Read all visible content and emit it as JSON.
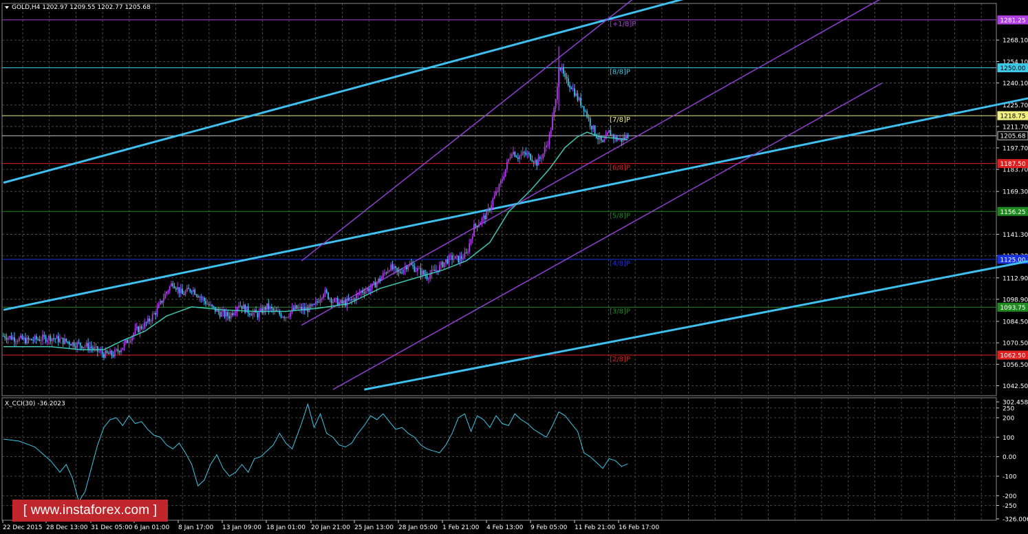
{
  "header": {
    "symbol_line": "GOLD,H4  1202.97 1209.55 1202.77 1205.68",
    "cci_line": "X_CCI(30) -36.2023"
  },
  "price_axis": {
    "ticks": [
      1268.1,
      1254.1,
      1240.1,
      1225.7,
      1211.7,
      1197.7,
      1183.7,
      1169.3,
      1141.3,
      1127.3,
      1112.9,
      1098.9,
      1084.5,
      1070.5,
      1056.5,
      1042.5
    ]
  },
  "time_axis": {
    "labels": [
      "22 Dec 2015",
      "28 Dec 13:00",
      "31 Dec 05:00",
      "6 Jan 01:00",
      "8 Jan 17:00",
      "13 Jan 09:00",
      "18 Jan 01:00",
      "20 Jan 21:00",
      "25 Jan 13:00",
      "28 Jan 05:00",
      "1 Feb 21:00",
      "4 Feb 13:00",
      "9 Feb 05:00",
      "11 Feb 21:00",
      "16 Feb 17:00"
    ]
  },
  "levels": [
    {
      "label": "[+1/8]P",
      "value": 1281.25,
      "value_text": "1281.25",
      "color": "#b040e0"
    },
    {
      "label": "[8/8]P",
      "value": 1250.0,
      "value_text": "1250.00",
      "color": "#3ec8e8"
    },
    {
      "label": "[7/8]P",
      "value": 1218.75,
      "value_text": "1218.75",
      "color": "#f0f080"
    },
    {
      "label": "",
      "value": 1205.68,
      "value_text": "1205.68",
      "color": "#c8c8c8"
    },
    {
      "label": "[6/8]P",
      "value": 1187.5,
      "value_text": "1187.50",
      "color": "#e02020"
    },
    {
      "label": "[5/8]P",
      "value": 1156.25,
      "value_text": "1156.25",
      "color": "#1f8a1f"
    },
    {
      "label": "[4/8]P",
      "value": 1125.0,
      "value_text": "1125.00",
      "color": "#1a33e0"
    },
    {
      "label": "[3/8]P",
      "value": 1093.75,
      "value_text": "1093.75",
      "color": "#1f8a1f"
    },
    {
      "label": "[2/8]P",
      "value": 1062.5,
      "value_text": "1062.50",
      "color": "#e02020"
    }
  ],
  "cci_axis": {
    "ticks": [
      "302.4585",
      "250",
      "200",
      "100",
      "0.00",
      "-100",
      "-200",
      "-250",
      "-326.0061"
    ]
  },
  "chart_data": [
    {
      "type": "candlestick",
      "title": "GOLD,H4",
      "ylim": [
        1036,
        1292
      ],
      "bar_count": 300,
      "close_path": [
        [
          0,
          1075
        ],
        [
          15,
          1072
        ],
        [
          30,
          1074
        ],
        [
          45,
          1070
        ],
        [
          55,
          1068
        ],
        [
          64,
          1063
        ],
        [
          70,
          1063
        ],
        [
          76,
          1068
        ],
        [
          84,
          1078
        ],
        [
          92,
          1084
        ],
        [
          98,
          1092
        ],
        [
          104,
          1104
        ],
        [
          108,
          1110
        ],
        [
          114,
          1102
        ],
        [
          120,
          1106
        ],
        [
          126,
          1100
        ],
        [
          132,
          1094
        ],
        [
          138,
          1090
        ],
        [
          144,
          1088
        ],
        [
          150,
          1096
        ],
        [
          156,
          1091
        ],
        [
          162,
          1089
        ],
        [
          168,
          1094
        ],
        [
          174,
          1090
        ],
        [
          180,
          1088
        ],
        [
          186,
          1093
        ],
        [
          192,
          1092
        ],
        [
          198,
          1094
        ],
        [
          204,
          1104
        ],
        [
          210,
          1098
        ],
        [
          216,
          1096
        ],
        [
          222,
          1098
        ],
        [
          228,
          1104
        ],
        [
          234,
          1106
        ],
        [
          240,
          1112
        ],
        [
          246,
          1120
        ],
        [
          252,
          1116
        ],
        [
          258,
          1122
        ],
        [
          264,
          1118
        ],
        [
          270,
          1114
        ],
        [
          276,
          1118
        ],
        [
          282,
          1124
        ],
        [
          286,
          1126
        ],
        [
          290,
          1125
        ],
        [
          295,
          1128
        ],
        [
          300,
          1146
        ],
        [
          304,
          1150
        ],
        [
          308,
          1154
        ],
        [
          312,
          1164
        ],
        [
          316,
          1172
        ],
        [
          320,
          1184
        ],
        [
          324,
          1196
        ],
        [
          328,
          1192
        ],
        [
          332,
          1194
        ],
        [
          336,
          1192
        ],
        [
          340,
          1188
        ],
        [
          344,
          1194
        ],
        [
          348,
          1205
        ],
        [
          352,
          1228
        ],
        [
          354,
          1252
        ],
        [
          356,
          1248
        ],
        [
          358,
          1242
        ],
        [
          362,
          1238
        ],
        [
          366,
          1230
        ],
        [
          370,
          1224
        ],
        [
          374,
          1214
        ],
        [
          378,
          1206
        ],
        [
          382,
          1200
        ],
        [
          386,
          1208
        ],
        [
          390,
          1204
        ],
        [
          394,
          1203
        ],
        [
          398,
          1205.68
        ]
      ],
      "moving_average_path": [
        [
          0,
          1068
        ],
        [
          30,
          1068
        ],
        [
          50,
          1066
        ],
        [
          64,
          1066
        ],
        [
          76,
          1072
        ],
        [
          90,
          1078
        ],
        [
          104,
          1088
        ],
        [
          120,
          1094
        ],
        [
          140,
          1092
        ],
        [
          160,
          1091
        ],
        [
          180,
          1091
        ],
        [
          200,
          1093
        ],
        [
          220,
          1096
        ],
        [
          240,
          1106
        ],
        [
          260,
          1112
        ],
        [
          280,
          1118
        ],
        [
          295,
          1124
        ],
        [
          310,
          1136
        ],
        [
          322,
          1156
        ],
        [
          336,
          1170
        ],
        [
          348,
          1184
        ],
        [
          358,
          1198
        ],
        [
          366,
          1205
        ],
        [
          372,
          1208
        ],
        [
          380,
          1205
        ],
        [
          390,
          1204
        ],
        [
          398,
          1203
        ]
      ],
      "trend_lines": [
        {
          "name": "upper-blue",
          "points": [
            [
              0,
              1175
            ],
            [
              470,
              1305
            ]
          ],
          "color": "#3ec0f0"
        },
        {
          "name": "middle-blue",
          "points": [
            [
              0,
              1092
            ],
            [
              700,
              1240
            ]
          ],
          "color": "#3ec0f0"
        },
        {
          "name": "lower-blue",
          "points": [
            [
              230,
              1040
            ],
            [
              700,
              1133
            ]
          ],
          "color": "#3ec0f0"
        },
        {
          "name": "channel-upper",
          "points": [
            [
              190,
              1124
            ],
            [
              420,
              1310
            ]
          ],
          "color": "#9040d0"
        },
        {
          "name": "channel-mid",
          "points": [
            [
              190,
              1082
            ],
            [
              620,
              1330
            ]
          ],
          "color": "#9040d0"
        },
        {
          "name": "channel-lower",
          "points": [
            [
              210,
              1040
            ],
            [
              560,
              1240
            ]
          ],
          "color": "#9040d0"
        }
      ]
    },
    {
      "type": "line",
      "title": "X_CCI(30) -36.2023",
      "ylim": [
        -326.0061,
        302.4585
      ],
      "values": [
        [
          0,
          90
        ],
        [
          10,
          80
        ],
        [
          20,
          50
        ],
        [
          30,
          -20
        ],
        [
          36,
          -80
        ],
        [
          40,
          -40
        ],
        [
          44,
          -110
        ],
        [
          48,
          -230
        ],
        [
          52,
          -180
        ],
        [
          56,
          -60
        ],
        [
          60,
          60
        ],
        [
          64,
          150
        ],
        [
          68,
          190
        ],
        [
          72,
          200
        ],
        [
          76,
          160
        ],
        [
          80,
          210
        ],
        [
          84,
          170
        ],
        [
          88,
          180
        ],
        [
          92,
          140
        ],
        [
          96,
          110
        ],
        [
          100,
          100
        ],
        [
          104,
          60
        ],
        [
          108,
          40
        ],
        [
          112,
          70
        ],
        [
          116,
          20
        ],
        [
          120,
          -40
        ],
        [
          124,
          -150
        ],
        [
          128,
          -120
        ],
        [
          132,
          -40
        ],
        [
          136,
          10
        ],
        [
          140,
          -60
        ],
        [
          144,
          -100
        ],
        [
          148,
          -80
        ],
        [
          152,
          -40
        ],
        [
          156,
          -80
        ],
        [
          160,
          -10
        ],
        [
          164,
          0
        ],
        [
          168,
          30
        ],
        [
          172,
          60
        ],
        [
          176,
          120
        ],
        [
          180,
          70
        ],
        [
          184,
          40
        ],
        [
          190,
          170
        ],
        [
          194,
          270
        ],
        [
          198,
          150
        ],
        [
          202,
          220
        ],
        [
          206,
          120
        ],
        [
          210,
          100
        ],
        [
          214,
          60
        ],
        [
          218,
          50
        ],
        [
          222,
          70
        ],
        [
          226,
          120
        ],
        [
          230,
          160
        ],
        [
          234,
          210
        ],
        [
          238,
          190
        ],
        [
          242,
          220
        ],
        [
          246,
          180
        ],
        [
          250,
          140
        ],
        [
          254,
          150
        ],
        [
          258,
          120
        ],
        [
          262,
          100
        ],
        [
          266,
          60
        ],
        [
          270,
          40
        ],
        [
          274,
          30
        ],
        [
          278,
          20
        ],
        [
          282,
          60
        ],
        [
          286,
          120
        ],
        [
          290,
          200
        ],
        [
          294,
          220
        ],
        [
          298,
          130
        ],
        [
          302,
          210
        ],
        [
          306,
          190
        ],
        [
          310,
          150
        ],
        [
          314,
          210
        ],
        [
          318,
          170
        ],
        [
          322,
          160
        ],
        [
          326,
          220
        ],
        [
          330,
          190
        ],
        [
          334,
          170
        ],
        [
          338,
          140
        ],
        [
          342,
          120
        ],
        [
          346,
          100
        ],
        [
          350,
          160
        ],
        [
          354,
          230
        ],
        [
          358,
          210
        ],
        [
          362,
          170
        ],
        [
          366,
          130
        ],
        [
          370,
          20
        ],
        [
          374,
          0
        ],
        [
          378,
          -30
        ],
        [
          382,
          -60
        ],
        [
          386,
          -10
        ],
        [
          390,
          -20
        ],
        [
          394,
          -50
        ],
        [
          398,
          -36.2023
        ]
      ]
    }
  ],
  "watermark": {
    "text": "www.instaforex.com",
    "bracket_left": "[",
    "bracket_right": "]"
  }
}
